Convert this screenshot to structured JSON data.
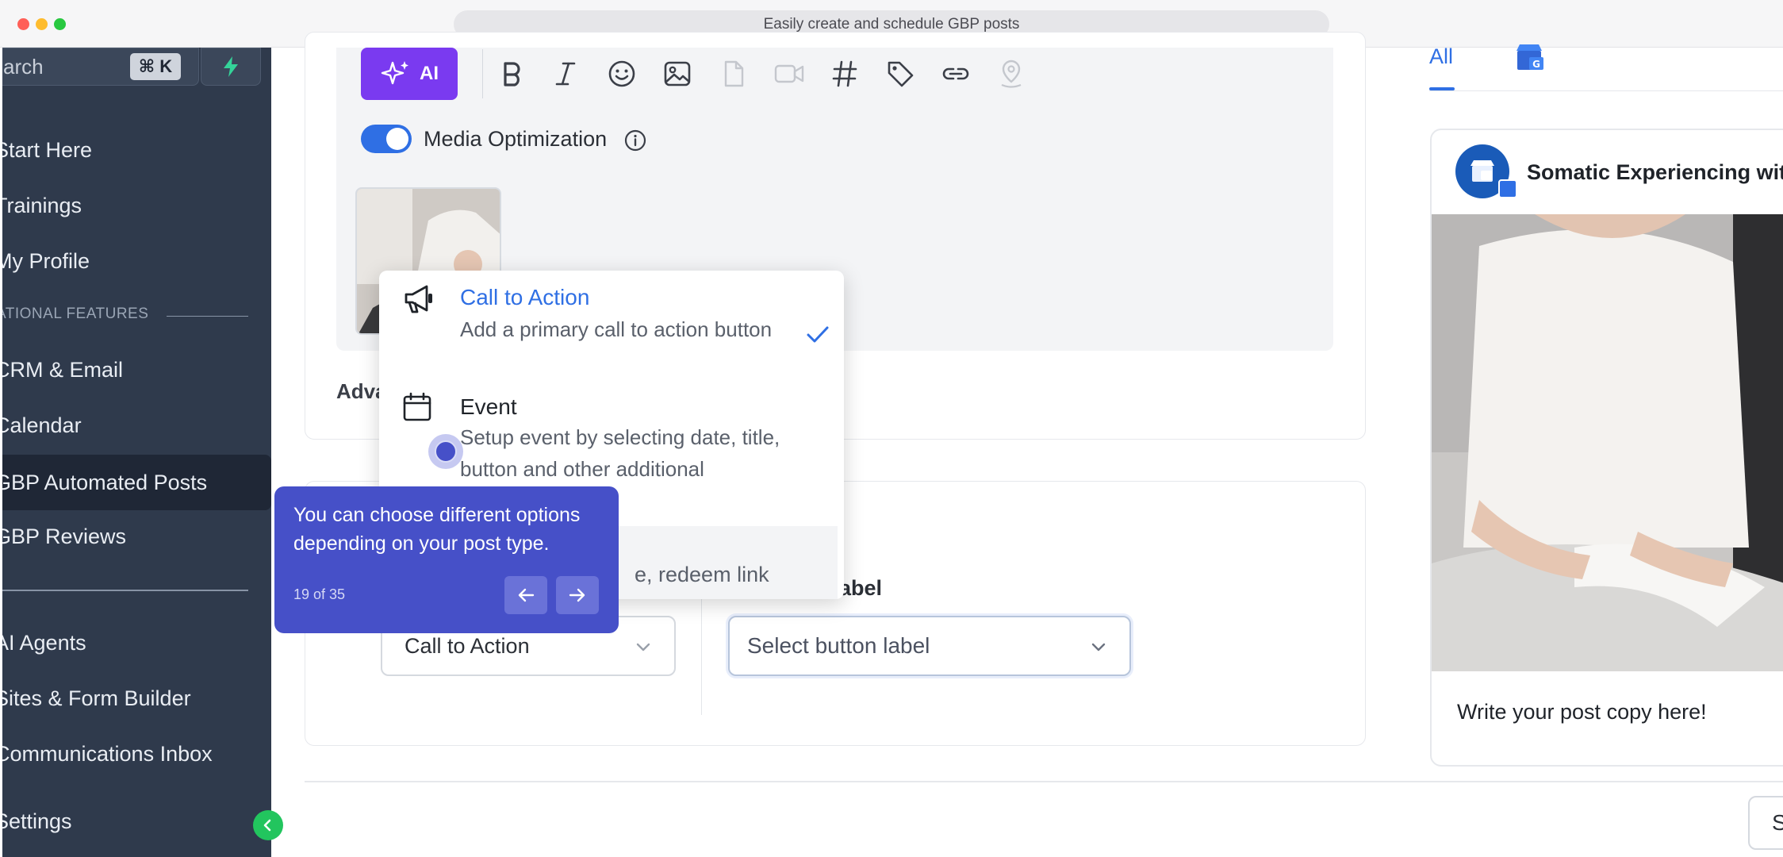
{
  "window": {
    "url_title": "Easily create and schedule GBP posts"
  },
  "sidebar": {
    "search_placeholder": "arch",
    "search_shortcut": "⌘ K",
    "items": [
      {
        "label": "Start Here"
      },
      {
        "label": "Trainings"
      },
      {
        "label": "My Profile"
      },
      {
        "label": "CRM & Email"
      },
      {
        "label": "Calendar"
      },
      {
        "label": "GBP Automated Posts"
      },
      {
        "label": "GBP Reviews"
      },
      {
        "label": "AI Agents"
      },
      {
        "label": "Sites & Form Builder"
      },
      {
        "label": "Communications Inbox"
      },
      {
        "label": "Settings"
      }
    ],
    "section_label": "ATIONAL FEATURES"
  },
  "editor": {
    "ai_label": "AI",
    "media_optimization_label": "Media Optimization",
    "advanced_label": "Adva"
  },
  "dropdown": {
    "items": [
      {
        "title": "Call to Action",
        "description": "Add a primary call to action button",
        "selected": true
      },
      {
        "title": "Event",
        "description": "Setup event by selecting date, title, button and other additional",
        "selected": false
      },
      {
        "title": "",
        "description": "e, redeem link",
        "selected": false
      }
    ]
  },
  "cta": {
    "post_type_value": "Call to Action",
    "button_label_title": "on label",
    "button_label_placeholder": "Select button label",
    "bottom_button": "S"
  },
  "preview": {
    "tab_all": "All",
    "business_name": "Somatic Experiencing with",
    "post_copy": "Write your post copy here!"
  },
  "tour": {
    "text": "You can choose different options depending on your post type.",
    "counter": "19 of 35"
  },
  "colors": {
    "accent": "#2f6fe4",
    "ai_purple": "#7a3af0",
    "tour_indigo": "#4650c8",
    "sidebar_bg": "#2f3a4c",
    "success_green": "#22c55e"
  }
}
